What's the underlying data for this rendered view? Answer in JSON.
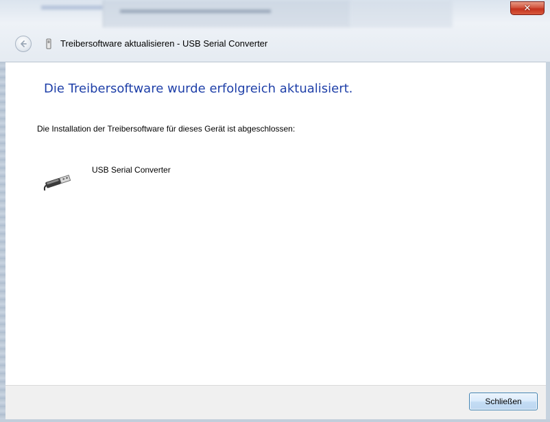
{
  "window": {
    "title": "Treibersoftware aktualisieren - USB Serial Converter",
    "close_glyph": "✕"
  },
  "main": {
    "heading": "Die Treibersoftware wurde erfolgreich aktualisiert.",
    "description": "Die Installation der Treibersoftware für dieses Gerät ist abgeschlossen:",
    "device_name": "USB Serial Converter",
    "device_icon": "usb-plug-icon"
  },
  "footer": {
    "close_button_label": "Schließen"
  },
  "colors": {
    "heading": "#1e3fa8",
    "close_button_bg": "#c4321d",
    "footer_bg": "#f0f0f0"
  }
}
